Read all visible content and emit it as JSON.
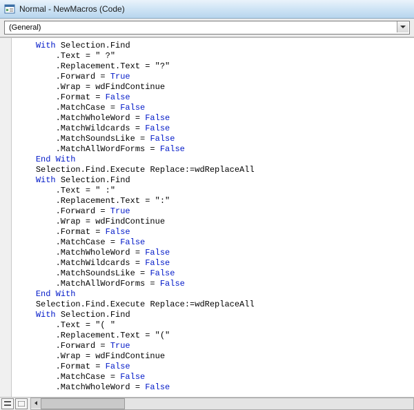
{
  "window": {
    "title": "Normal - NewMacros (Code)"
  },
  "combo": {
    "object": "(General)"
  },
  "code": {
    "indent_with": "    ",
    "indent_block": "        ",
    "lines": [
      {
        "i": 1,
        "t": [
          {
            "k": "kw",
            "s": "With"
          },
          {
            "s": " Selection.Find"
          }
        ]
      },
      {
        "i": 2,
        "t": [
          {
            "s": ".Text = "
          },
          {
            "k": "str",
            "s": "\" ?\""
          }
        ]
      },
      {
        "i": 2,
        "t": [
          {
            "s": ".Replacement.Text = "
          },
          {
            "k": "str",
            "s": "\"?\""
          }
        ]
      },
      {
        "i": 2,
        "t": [
          {
            "s": ".Forward = "
          },
          {
            "k": "kw",
            "s": "True"
          }
        ]
      },
      {
        "i": 2,
        "t": [
          {
            "s": ".Wrap = wdFindContinue"
          }
        ]
      },
      {
        "i": 2,
        "t": [
          {
            "s": ".Format = "
          },
          {
            "k": "kw",
            "s": "False"
          }
        ]
      },
      {
        "i": 2,
        "t": [
          {
            "s": ".MatchCase = "
          },
          {
            "k": "kw",
            "s": "False"
          }
        ]
      },
      {
        "i": 2,
        "t": [
          {
            "s": ".MatchWholeWord = "
          },
          {
            "k": "kw",
            "s": "False"
          }
        ]
      },
      {
        "i": 2,
        "t": [
          {
            "s": ".MatchWildcards = "
          },
          {
            "k": "kw",
            "s": "False"
          }
        ]
      },
      {
        "i": 2,
        "t": [
          {
            "s": ".MatchSoundsLike = "
          },
          {
            "k": "kw",
            "s": "False"
          }
        ]
      },
      {
        "i": 2,
        "t": [
          {
            "s": ".MatchAllWordForms = "
          },
          {
            "k": "kw",
            "s": "False"
          }
        ]
      },
      {
        "i": 1,
        "t": [
          {
            "k": "kw",
            "s": "End With"
          }
        ]
      },
      {
        "i": 1,
        "t": [
          {
            "s": "Selection.Find.Execute Replace:=wdReplaceAll"
          }
        ]
      },
      {
        "i": 1,
        "t": [
          {
            "k": "kw",
            "s": "With"
          },
          {
            "s": " Selection.Find"
          }
        ]
      },
      {
        "i": 2,
        "t": [
          {
            "s": ".Text = "
          },
          {
            "k": "str",
            "s": "\" :\""
          }
        ]
      },
      {
        "i": 2,
        "t": [
          {
            "s": ".Replacement.Text = "
          },
          {
            "k": "str",
            "s": "\":\""
          }
        ]
      },
      {
        "i": 2,
        "t": [
          {
            "s": ".Forward = "
          },
          {
            "k": "kw",
            "s": "True"
          }
        ]
      },
      {
        "i": 2,
        "t": [
          {
            "s": ".Wrap = wdFindContinue"
          }
        ]
      },
      {
        "i": 2,
        "t": [
          {
            "s": ".Format = "
          },
          {
            "k": "kw",
            "s": "False"
          }
        ]
      },
      {
        "i": 2,
        "t": [
          {
            "s": ".MatchCase = "
          },
          {
            "k": "kw",
            "s": "False"
          }
        ]
      },
      {
        "i": 2,
        "t": [
          {
            "s": ".MatchWholeWord = "
          },
          {
            "k": "kw",
            "s": "False"
          }
        ]
      },
      {
        "i": 2,
        "t": [
          {
            "s": ".MatchWildcards = "
          },
          {
            "k": "kw",
            "s": "False"
          }
        ]
      },
      {
        "i": 2,
        "t": [
          {
            "s": ".MatchSoundsLike = "
          },
          {
            "k": "kw",
            "s": "False"
          }
        ]
      },
      {
        "i": 2,
        "t": [
          {
            "s": ".MatchAllWordForms = "
          },
          {
            "k": "kw",
            "s": "False"
          }
        ]
      },
      {
        "i": 1,
        "t": [
          {
            "k": "kw",
            "s": "End With"
          }
        ]
      },
      {
        "i": 1,
        "t": [
          {
            "s": "Selection.Find.Execute Replace:=wdReplaceAll"
          }
        ]
      },
      {
        "i": 1,
        "t": [
          {
            "k": "kw",
            "s": "With"
          },
          {
            "s": " Selection.Find"
          }
        ]
      },
      {
        "i": 2,
        "t": [
          {
            "s": ".Text = "
          },
          {
            "k": "str",
            "s": "\"( \""
          }
        ]
      },
      {
        "i": 2,
        "t": [
          {
            "s": ".Replacement.Text = "
          },
          {
            "k": "str",
            "s": "\"(\""
          }
        ]
      },
      {
        "i": 2,
        "t": [
          {
            "s": ".Forward = "
          },
          {
            "k": "kw",
            "s": "True"
          }
        ]
      },
      {
        "i": 2,
        "t": [
          {
            "s": ".Wrap = wdFindContinue"
          }
        ]
      },
      {
        "i": 2,
        "t": [
          {
            "s": ".Format = "
          },
          {
            "k": "kw",
            "s": "False"
          }
        ]
      },
      {
        "i": 2,
        "t": [
          {
            "s": ".MatchCase = "
          },
          {
            "k": "kw",
            "s": "False"
          }
        ]
      },
      {
        "i": 2,
        "t": [
          {
            "s": ".MatchWholeWord = "
          },
          {
            "k": "kw",
            "s": "False"
          }
        ]
      }
    ]
  }
}
